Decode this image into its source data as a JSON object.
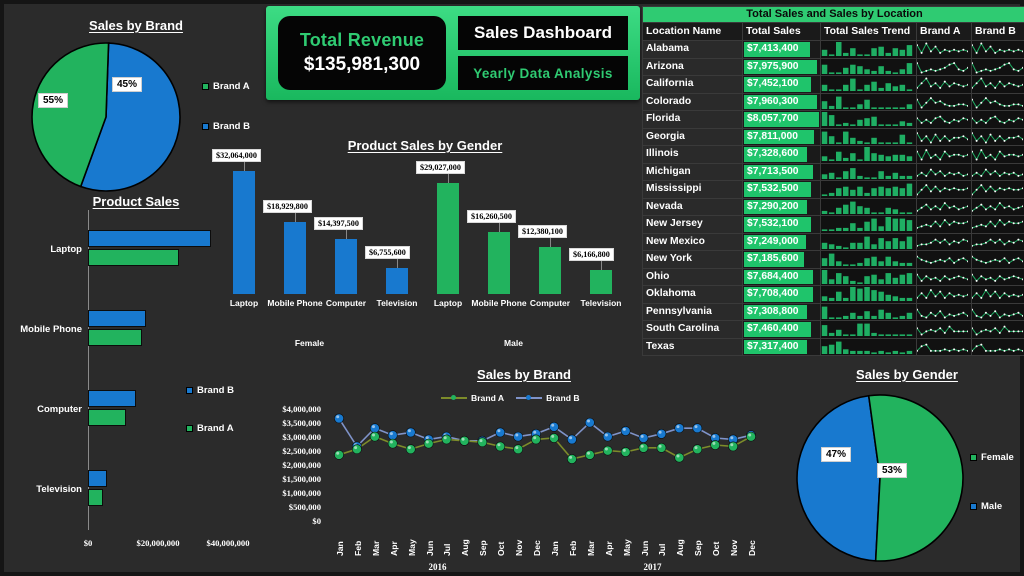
{
  "header": {
    "revenue_label": "Total Revenue",
    "revenue_value": "$135,981,300",
    "title": "Sales Dashboard",
    "subtitle": "Yearly Data  Analysis"
  },
  "colors": {
    "green": "#22b35e",
    "bright_green": "#2fcb72",
    "blue": "#1879cf",
    "olive": "#7d8c2a",
    "background": "#2b2b2b",
    "panel_black": "#050505"
  },
  "pie_brand": {
    "title": "Sales by Brand",
    "subtitle_below": "Product Sales",
    "legend": [
      {
        "label": "Brand A",
        "color": "#22b35e"
      },
      {
        "label": "Brand B",
        "color": "#1879cf"
      }
    ],
    "slices": [
      {
        "label": "Brand B",
        "pct": "55%",
        "value": 55,
        "color": "#1879cf"
      },
      {
        "label": "Brand A",
        "pct": "45%",
        "value": 45,
        "color": "#22b35e"
      }
    ]
  },
  "product_sales": {
    "title": "Product Sales",
    "legend": [
      {
        "label": "Brand B",
        "color": "#1879cf"
      },
      {
        "label": "Brand A",
        "color": "#22b35e"
      }
    ],
    "categories": [
      "Laptop",
      "Mobile Phone",
      "Computer",
      "Television"
    ],
    "xticks": [
      "$0",
      "$20,000,000",
      "$40,000,000"
    ],
    "xmax": 48000000,
    "series": [
      {
        "name": "Brand B",
        "color": "#1879cf",
        "values": [
          35000000,
          16600000,
          13800000,
          5300000
        ]
      },
      {
        "name": "Brand A",
        "color": "#22b35e",
        "values": [
          26000000,
          15300000,
          10900000,
          4400000
        ]
      }
    ]
  },
  "gender_chart": {
    "title": "Product Sales by Gender",
    "groups": [
      "Female",
      "Male"
    ],
    "categories": [
      "Laptop",
      "Mobile Phone",
      "Computer",
      "Television"
    ],
    "series": [
      {
        "group": "Female",
        "color": "#1879cf",
        "values": [
          32064000,
          18929800,
          14397500,
          6755600
        ],
        "labels": [
          "$32,064,000",
          "$18,929,800",
          "$14,397,500",
          "$6,755,600"
        ]
      },
      {
        "group": "Male",
        "color": "#22b35e",
        "values": [
          29027000,
          16260500,
          12380100,
          6166800
        ],
        "labels": [
          "$29,027,000",
          "$16,260,500",
          "$12,380,100",
          "$6,166,800"
        ]
      }
    ],
    "ymax": 34000000
  },
  "line_chart": {
    "title": "Sales by Brand",
    "legend": [
      {
        "label": "Brand A",
        "color": "#7d8c2a",
        "marker": "#22b35e"
      },
      {
        "label": "Brand B",
        "color": "#7f93c9",
        "marker": "#1879cf"
      }
    ],
    "outer_legend": [
      {
        "label": "Brand B",
        "color": "#1879cf"
      },
      {
        "label": "Brand A",
        "color": "#22b35e"
      }
    ],
    "yticks": [
      "$4,000,000",
      "$3,500,000",
      "$3,000,000",
      "$2,500,000",
      "$2,000,000",
      "$1,500,000",
      "$1,000,000",
      "$500,000",
      "$0"
    ],
    "ymax": 4000000,
    "ymin": 0,
    "years": [
      "2016",
      "2017"
    ],
    "months": [
      "Jan",
      "Feb",
      "Mar",
      "Apr",
      "May",
      "Jun",
      "Jul",
      "Aug",
      "Sep",
      "Oct",
      "Nov",
      "Dec",
      "Jan",
      "Feb",
      "Mar",
      "Apr",
      "May",
      "Jun",
      "Jul",
      "Aug",
      "Sep",
      "Oct",
      "Nov",
      "Dec"
    ],
    "series": [
      {
        "name": "Brand B",
        "color": "#1879cf",
        "values": [
          3700000,
          2700000,
          3350000,
          3100000,
          3200000,
          2950000,
          3050000,
          2900000,
          2900000,
          3200000,
          3050000,
          3150000,
          3400000,
          2950000,
          3550000,
          3050000,
          3250000,
          3000000,
          3150000,
          3350000,
          3350000,
          3000000,
          2950000,
          3100000
        ]
      },
      {
        "name": "Brand A",
        "color": "#22b35e",
        "values": [
          2400000,
          2600000,
          3050000,
          2800000,
          2600000,
          2800000,
          2950000,
          2900000,
          2850000,
          2700000,
          2600000,
          2950000,
          3000000,
          2250000,
          2400000,
          2550000,
          2500000,
          2650000,
          2650000,
          2300000,
          2600000,
          2750000,
          2700000,
          3050000
        ]
      }
    ]
  },
  "pie_gender": {
    "title": "Sales by Gender",
    "legend": [
      {
        "label": "Female",
        "color": "#22b35e"
      },
      {
        "label": "Male",
        "color": "#1879cf"
      }
    ],
    "slices": [
      {
        "label": "Male",
        "pct": "47%",
        "value": 47,
        "color": "#1879cf"
      },
      {
        "label": "Female",
        "pct": "53%",
        "value": 53,
        "color": "#22b35e"
      }
    ]
  },
  "location_table": {
    "caption": "Total Sales and Sales by Location",
    "headers": [
      "Location Name",
      "Total Sales",
      "Total Sales Trend",
      "Brand A",
      "Brand B"
    ],
    "rows": [
      {
        "location": "Alabama",
        "total_sales": "$7,413,400",
        "bar_pct": 88,
        "trend": [
          4,
          1,
          9,
          2,
          5,
          1,
          1,
          5,
          6,
          2,
          5,
          4,
          7
        ],
        "brand_a": [
          8,
          3,
          9,
          4,
          7,
          3,
          5,
          4,
          5,
          4,
          5,
          4
        ],
        "brand_b": [
          8,
          3,
          9,
          4,
          7,
          3,
          5,
          4,
          5,
          4,
          5,
          4
        ]
      },
      {
        "location": "Arizona",
        "total_sales": "$7,975,900",
        "bar_pct": 97,
        "trend": [
          6,
          1,
          1,
          4,
          6,
          5,
          3,
          2,
          5,
          2,
          1,
          3,
          7
        ],
        "brand_a": [
          8,
          2,
          3,
          4,
          3,
          4,
          5,
          7,
          8,
          4,
          3,
          5
        ],
        "brand_b": [
          8,
          2,
          3,
          4,
          3,
          4,
          5,
          7,
          8,
          4,
          3,
          5
        ]
      },
      {
        "location": "California",
        "total_sales": "$7,452,100",
        "bar_pct": 89,
        "trend": [
          4,
          1,
          1,
          4,
          8,
          1,
          4,
          6,
          2,
          5,
          3,
          4,
          1
        ],
        "brand_a": [
          3,
          6,
          9,
          4,
          6,
          3,
          7,
          4,
          6,
          5,
          4,
          5
        ],
        "brand_b": [
          3,
          6,
          9,
          4,
          6,
          3,
          7,
          4,
          6,
          5,
          4,
          5
        ]
      },
      {
        "location": "Colorado",
        "total_sales": "$7,960,300",
        "bar_pct": 97,
        "trend": [
          5,
          2,
          8,
          1,
          1,
          3,
          6,
          1,
          1,
          1,
          1,
          1,
          3
        ],
        "brand_a": [
          7,
          2,
          5,
          8,
          5,
          6,
          4,
          3,
          3,
          4,
          4,
          3
        ],
        "brand_b": [
          7,
          2,
          5,
          8,
          5,
          6,
          4,
          3,
          3,
          4,
          4,
          3
        ]
      },
      {
        "location": "Florida",
        "total_sales": "$8,057,700",
        "bar_pct": 100,
        "trend": [
          9,
          7,
          1,
          2,
          1,
          4,
          5,
          6,
          1,
          1,
          1,
          3,
          2
        ],
        "brand_a": [
          6,
          3,
          5,
          3,
          6,
          7,
          4,
          3,
          5,
          4,
          6,
          5
        ],
        "brand_b": [
          6,
          3,
          5,
          3,
          6,
          7,
          4,
          3,
          5,
          4,
          6,
          5
        ]
      },
      {
        "location": "Georgia",
        "total_sales": "$7,811,000",
        "bar_pct": 94,
        "trend": [
          8,
          5,
          1,
          8,
          4,
          2,
          1,
          4,
          1,
          1,
          1,
          6,
          1
        ],
        "brand_a": [
          8,
          3,
          6,
          2,
          7,
          3,
          6,
          3,
          5,
          5,
          6,
          4
        ],
        "brand_b": [
          8,
          3,
          6,
          2,
          7,
          3,
          6,
          3,
          5,
          5,
          6,
          4
        ]
      },
      {
        "location": "Illinois",
        "total_sales": "$7,328,600",
        "bar_pct": 85,
        "trend": [
          3,
          1,
          6,
          2,
          5,
          1,
          9,
          5,
          4,
          3,
          4,
          4,
          3
        ],
        "brand_a": [
          7,
          2,
          8,
          3,
          5,
          2,
          7,
          4,
          5,
          5,
          4,
          5
        ],
        "brand_b": [
          7,
          2,
          8,
          3,
          5,
          2,
          7,
          4,
          5,
          5,
          4,
          5
        ]
      },
      {
        "location": "Michigan",
        "total_sales": "$7,713,500",
        "bar_pct": 92,
        "trend": [
          3,
          4,
          1,
          5,
          7,
          2,
          1,
          1,
          5,
          2,
          4,
          2,
          2
        ],
        "brand_a": [
          3,
          5,
          3,
          7,
          4,
          6,
          3,
          5,
          4,
          5,
          3,
          4
        ],
        "brand_b": [
          3,
          5,
          3,
          7,
          4,
          6,
          3,
          5,
          4,
          5,
          3,
          4
        ]
      },
      {
        "location": "Mississippi",
        "total_sales": "$7,532,500",
        "bar_pct": 90,
        "trend": [
          1,
          2,
          5,
          6,
          4,
          6,
          2,
          5,
          6,
          5,
          6,
          5,
          8
        ],
        "brand_a": [
          2,
          5,
          8,
          4,
          7,
          4,
          6,
          5,
          6,
          5,
          5,
          6
        ],
        "brand_b": [
          2,
          5,
          8,
          4,
          7,
          4,
          6,
          5,
          6,
          5,
          5,
          6
        ]
      },
      {
        "location": "Nevada",
        "total_sales": "$7,290,200",
        "bar_pct": 84,
        "trend": [
          2,
          1,
          4,
          6,
          8,
          5,
          4,
          1,
          1,
          4,
          3,
          1,
          1
        ],
        "brand_a": [
          3,
          5,
          7,
          4,
          6,
          4,
          8,
          5,
          6,
          4,
          5,
          6
        ],
        "brand_b": [
          3,
          5,
          7,
          4,
          6,
          4,
          8,
          5,
          6,
          4,
          5,
          6
        ]
      },
      {
        "location": "New Jersey",
        "total_sales": "$7,532,100",
        "bar_pct": 90,
        "trend": [
          1,
          1,
          2,
          2,
          5,
          2,
          6,
          8,
          3,
          9,
          8,
          8,
          7
        ],
        "brand_a": [
          3,
          4,
          5,
          4,
          7,
          4,
          8,
          5,
          7,
          6,
          6,
          7
        ],
        "brand_b": [
          3,
          4,
          5,
          4,
          7,
          4,
          8,
          5,
          7,
          6,
          6,
          7
        ]
      },
      {
        "location": "New Mexico",
        "total_sales": "$7,249,000",
        "bar_pct": 83,
        "trend": [
          4,
          3,
          2,
          1,
          4,
          4,
          8,
          3,
          7,
          5,
          7,
          5,
          8
        ],
        "brand_a": [
          3,
          4,
          4,
          5,
          7,
          5,
          7,
          4,
          6,
          5,
          7,
          6
        ],
        "brand_b": [
          3,
          4,
          4,
          5,
          7,
          5,
          7,
          4,
          6,
          5,
          7,
          6
        ]
      },
      {
        "location": "New York",
        "total_sales": "$7,185,600",
        "bar_pct": 81,
        "trend": [
          5,
          8,
          3,
          1,
          1,
          2,
          5,
          6,
          3,
          6,
          3,
          2,
          2
        ],
        "brand_a": [
          7,
          5,
          4,
          3,
          4,
          5,
          4,
          6,
          3,
          5,
          6,
          4
        ],
        "brand_b": [
          7,
          5,
          4,
          3,
          4,
          5,
          4,
          6,
          3,
          5,
          6,
          4
        ]
      },
      {
        "location": "Ohio",
        "total_sales": "$7,684,400",
        "bar_pct": 92,
        "trend": [
          9,
          3,
          7,
          5,
          2,
          1,
          5,
          6,
          3,
          7,
          4,
          6,
          7
        ],
        "brand_a": [
          7,
          3,
          6,
          4,
          5,
          3,
          6,
          4,
          5,
          6,
          5,
          4
        ],
        "brand_b": [
          7,
          3,
          6,
          4,
          5,
          3,
          6,
          4,
          5,
          6,
          5,
          4
        ]
      },
      {
        "location": "Oklahoma",
        "total_sales": "$7,708,400",
        "bar_pct": 92,
        "trend": [
          3,
          2,
          6,
          2,
          9,
          8,
          9,
          7,
          6,
          4,
          3,
          2,
          2
        ],
        "brand_a": [
          3,
          6,
          3,
          8,
          4,
          7,
          3,
          6,
          4,
          5,
          4,
          5
        ],
        "brand_b": [
          3,
          6,
          3,
          8,
          4,
          7,
          3,
          6,
          4,
          5,
          4,
          5
        ]
      },
      {
        "location": "Pennsylvania",
        "total_sales": "$7,308,800",
        "bar_pct": 85,
        "trend": [
          8,
          1,
          1,
          2,
          4,
          2,
          5,
          2,
          6,
          4,
          1,
          2,
          4
        ],
        "brand_a": [
          7,
          3,
          2,
          5,
          3,
          6,
          2,
          4,
          3,
          4,
          5,
          3
        ],
        "brand_b": [
          7,
          3,
          2,
          5,
          3,
          6,
          2,
          4,
          3,
          4,
          5,
          3
        ]
      },
      {
        "location": "South Carolina",
        "total_sales": "$7,460,400",
        "bar_pct": 89,
        "trend": [
          7,
          2,
          4,
          1,
          1,
          8,
          8,
          2,
          1,
          1,
          1,
          1,
          1
        ],
        "brand_a": [
          6,
          2,
          4,
          5,
          4,
          6,
          3,
          7,
          4,
          4,
          4,
          4
        ],
        "brand_b": [
          6,
          2,
          4,
          5,
          4,
          6,
          3,
          7,
          4,
          4,
          4,
          4
        ]
      },
      {
        "location": "Texas",
        "total_sales": "$7,317,400",
        "bar_pct": 85,
        "trend": [
          5,
          6,
          8,
          3,
          2,
          2,
          2,
          1,
          2,
          1,
          2,
          1,
          2
        ],
        "brand_a": [
          3,
          6,
          7,
          3,
          3,
          3,
          4,
          3,
          4,
          3,
          4,
          3
        ],
        "brand_b": [
          3,
          6,
          7,
          3,
          3,
          3,
          4,
          3,
          4,
          3,
          4,
          3
        ]
      }
    ]
  }
}
